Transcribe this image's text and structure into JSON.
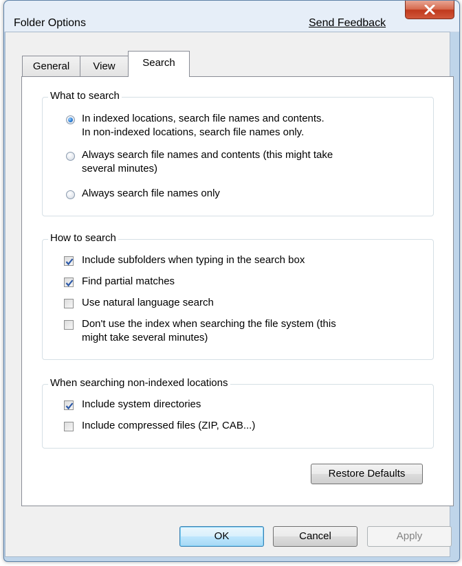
{
  "window": {
    "title": "Folder Options",
    "send_feedback": "Send Feedback",
    "close_icon": "close-x-icon"
  },
  "tabs": [
    {
      "label": "General",
      "active": false
    },
    {
      "label": "View",
      "active": false
    },
    {
      "label": "Search",
      "active": true
    }
  ],
  "what_to_search": {
    "legend": "What to search",
    "options": [
      {
        "line1": "In indexed locations, search file names and contents.",
        "line2": "In non-indexed locations, search file names only.",
        "selected": true
      },
      {
        "line1": "Always search file names and contents (this might take",
        "line2": "several minutes)",
        "selected": false
      },
      {
        "line1": "Always search file names only",
        "line2": "",
        "selected": false
      }
    ]
  },
  "how_to_search": {
    "legend": "How to search",
    "options": [
      {
        "line1": "Include subfolders when typing in the search box",
        "line2": "",
        "checked": true
      },
      {
        "line1": "Find partial matches",
        "line2": "",
        "checked": true
      },
      {
        "line1": "Use natural language search",
        "line2": "",
        "checked": false
      },
      {
        "line1": "Don't use the index when searching the file system (this",
        "line2": "might take several minutes)",
        "checked": false
      }
    ]
  },
  "non_indexed": {
    "legend": "When searching non-indexed locations",
    "options": [
      {
        "line1": "Include system directories",
        "checked": true
      },
      {
        "line1": "Include compressed files (ZIP, CAB...)",
        "checked": false
      }
    ]
  },
  "buttons": {
    "restore_defaults": "Restore Defaults",
    "ok": "OK",
    "cancel": "Cancel",
    "apply": "Apply"
  },
  "colors": {
    "window_frame": "#bfd5ea",
    "accent": "#2a7fd6",
    "close_button": "#c0391c"
  }
}
